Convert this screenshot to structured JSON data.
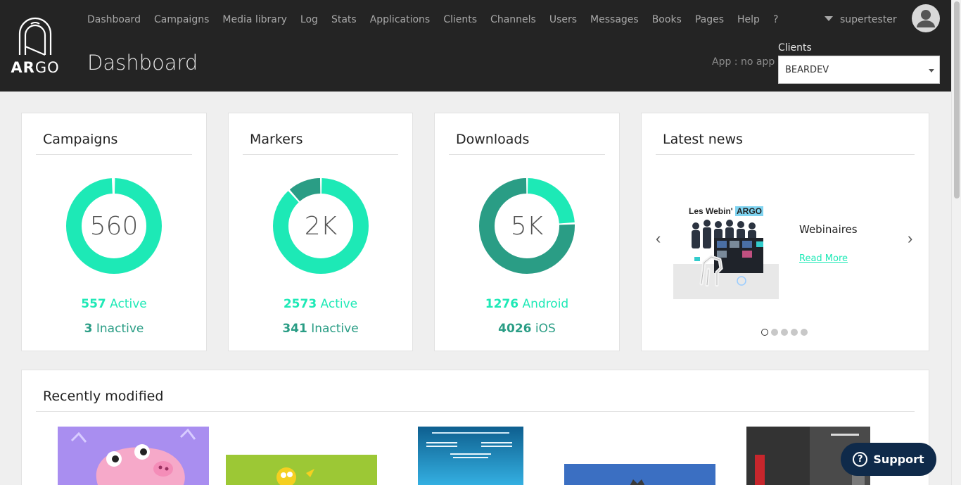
{
  "brand": {
    "logo_text_bold": "AR",
    "logo_text_rest": "GO"
  },
  "nav": {
    "items": [
      "Dashboard",
      "Campaigns",
      "Media library",
      "Log",
      "Stats",
      "Applications",
      "Clients",
      "Channels",
      "Users",
      "Messages",
      "Books",
      "Pages",
      "Help",
      "?"
    ]
  },
  "header": {
    "page_title": "Dashboard",
    "username": "supertester",
    "app_label": "App : no app",
    "clients_label": "Clients",
    "clients_selected": "BEARDEV"
  },
  "colors": {
    "accent": "#1de9b6",
    "accent_dark": "#2a9d85",
    "header_bg": "#242424",
    "support_bg": "#0f2a4a"
  },
  "cards": {
    "campaigns": {
      "title": "Campaigns",
      "center": "560",
      "a_value": "557",
      "a_label": " Active",
      "b_value": "3",
      "b_label": " Inactive",
      "a_fraction": 0.995
    },
    "markers": {
      "title": "Markers",
      "center": "2K",
      "a_value": "2573",
      "a_label": " Active",
      "b_value": "341",
      "b_label": " Inactive",
      "a_fraction": 0.883
    },
    "downloads": {
      "title": "Downloads",
      "center": "5K",
      "a_value": "1276",
      "a_label": " Android",
      "b_value": "4026",
      "b_label": " iOS",
      "a_fraction": 0.241
    }
  },
  "news": {
    "title": "Latest news",
    "image_caption_plain": "Les Webin'",
    "image_caption_highlight": "ARGO",
    "heading": "Webinaires",
    "link": "Read More",
    "prev_icon": "‹",
    "next_icon": "›",
    "slide_count": 5,
    "active_slide": 1
  },
  "recent": {
    "title": "Recently modified"
  },
  "support": {
    "icon": "?",
    "label": "Support"
  }
}
